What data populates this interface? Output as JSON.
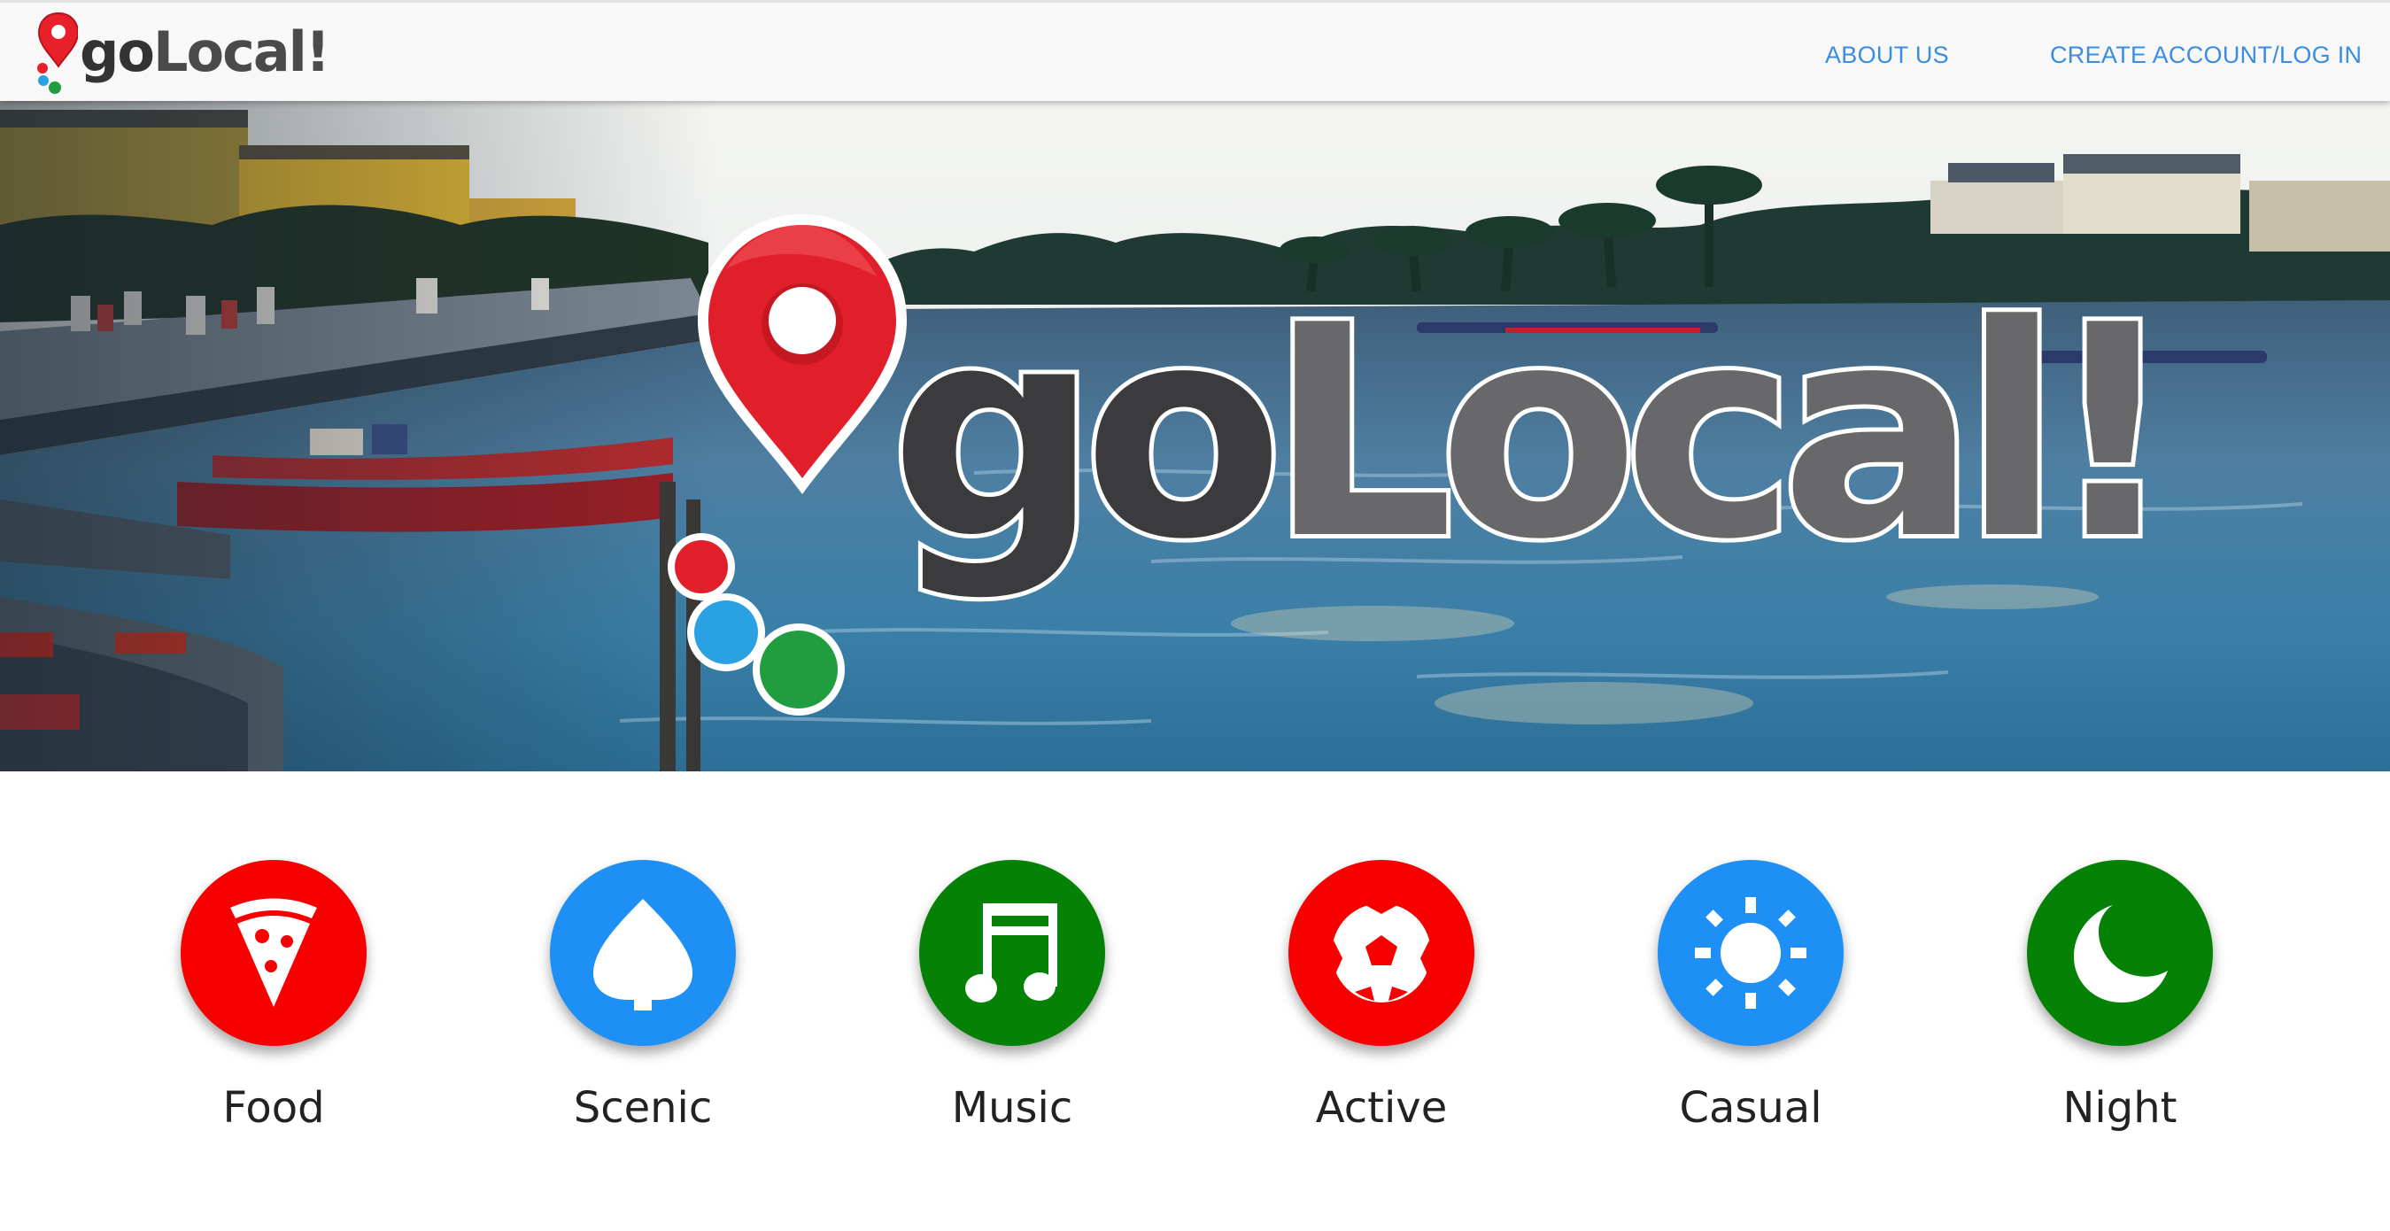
{
  "brand": {
    "word_part1": "go",
    "word_part2": "Local!",
    "pin_color": "#e8202a",
    "dot_colors": [
      "#e8202a",
      "#2aa1e3",
      "#1f9d3f"
    ]
  },
  "nav": {
    "about_label": "ABOUT US",
    "account_label": "CREATE ACCOUNT/LOG IN",
    "link_color": "#3a8de0"
  },
  "hero": {
    "word_part1": "go",
    "word_part2": "Local!"
  },
  "categories": [
    {
      "label": "Food",
      "icon": "pizza-icon",
      "color": "#f70000"
    },
    {
      "label": "Scenic",
      "icon": "leaf-icon",
      "color": "#1e8ff5"
    },
    {
      "label": "Music",
      "icon": "music-note-icon",
      "color": "#058205"
    },
    {
      "label": "Active",
      "icon": "soccer-ball-icon",
      "color": "#f70000"
    },
    {
      "label": "Casual",
      "icon": "sun-icon",
      "color": "#1e8ff5"
    },
    {
      "label": "Night",
      "icon": "moon-icon",
      "color": "#058205"
    }
  ]
}
